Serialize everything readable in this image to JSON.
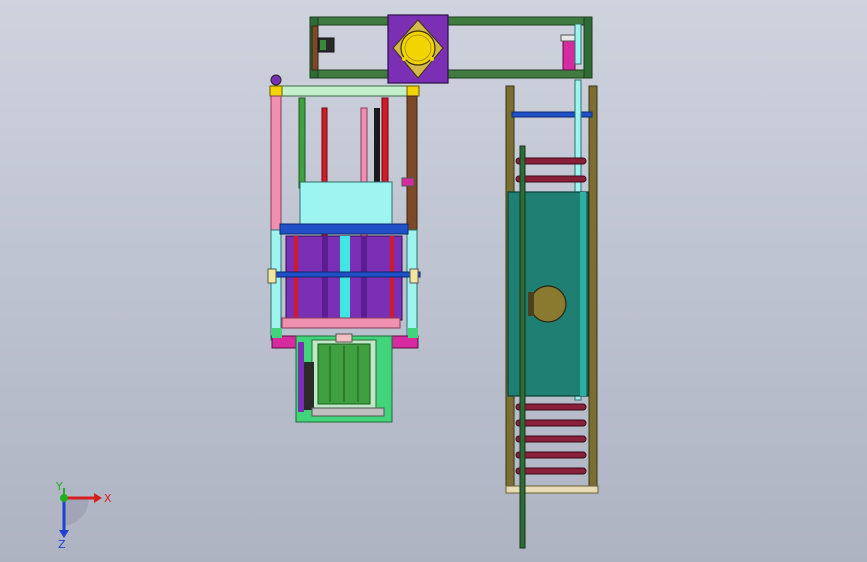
{
  "viewport": {
    "background_top": "#cfd3de",
    "background_bottom": "#aeb3c2"
  },
  "colors": {
    "frame_green": "#3f7a3f",
    "frame_dark_green": "#2e6b35",
    "purple": "#7b2fb5",
    "yellow": "#f2d400",
    "teal": "#1f7f73",
    "cyan": "#9ef5f0",
    "blue": "#2050c8",
    "brown": "#7b4a28",
    "pink": "#f090b0",
    "magenta": "#d62aa0",
    "red": "#d21a2a",
    "roller_red": "#8a1f3a",
    "olive": "#7a6f30",
    "light_green": "#42d47a",
    "beige": "#e6dcb8"
  },
  "triad": {
    "x_label": "X",
    "y_label": "Y",
    "z_label": "Z",
    "x_color": "#d62020",
    "y_color": "#22b022",
    "z_color": "#2040d0"
  },
  "icons": {
    "triad": "coordinate-triad-icon"
  }
}
